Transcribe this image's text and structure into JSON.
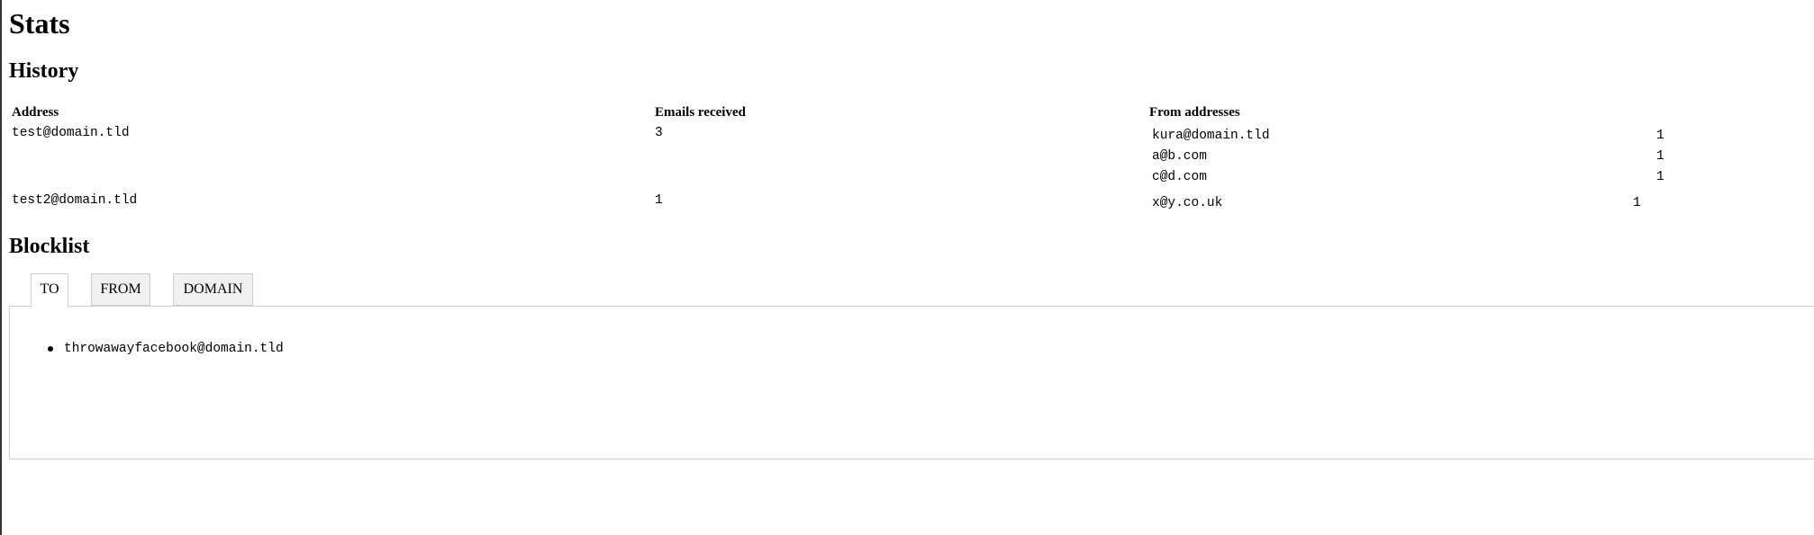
{
  "page": {
    "title": "Stats"
  },
  "history": {
    "title": "History",
    "columns": {
      "address": "Address",
      "emails_received": "Emails received",
      "from_addresses": "From addresses"
    },
    "rows": [
      {
        "address": "test@domain.tld",
        "emails_received": "3",
        "from": [
          {
            "address": "kura@domain.tld",
            "count": "1"
          },
          {
            "address": "a@b.com",
            "count": "1"
          },
          {
            "address": "c@d.com",
            "count": "1"
          }
        ]
      },
      {
        "address": "test2@domain.tld",
        "emails_received": "1",
        "from": [
          {
            "address": "x@y.co.uk",
            "count": "1"
          }
        ]
      }
    ]
  },
  "blocklist": {
    "title": "Blocklist",
    "tabs": [
      {
        "label": "TO",
        "active": true
      },
      {
        "label": "FROM",
        "active": false
      },
      {
        "label": "DOMAIN",
        "active": false
      }
    ],
    "items": [
      "throwawayfacebook@domain.tld"
    ]
  }
}
